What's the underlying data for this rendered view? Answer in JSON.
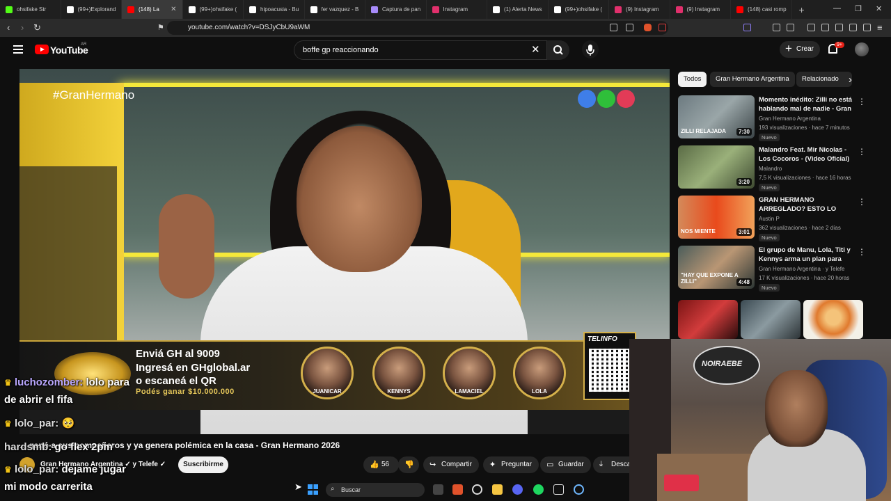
{
  "browser": {
    "tabs": [
      {
        "label": "ohsifake Str",
        "color": "#53fc18"
      },
      {
        "label": "(99+)Explorand",
        "color": "#ffffff"
      },
      {
        "label": "(148) La",
        "color": "#ff0000",
        "active": true
      },
      {
        "label": "(99+)ohsifake (",
        "color": "#ffffff"
      },
      {
        "label": "hipoacusia - Bu",
        "color": "#ffffff"
      },
      {
        "label": "fer vazquez - B",
        "color": "#ffffff"
      },
      {
        "label": "Captura de pan",
        "color": "#a78bfa"
      },
      {
        "label": "Instagram",
        "color": "#e1306c"
      },
      {
        "label": "(1) Alerta News",
        "color": "#ffffff"
      },
      {
        "label": "(99+)ohsifake (",
        "color": "#ffffff"
      },
      {
        "label": "(9) Instagram",
        "color": "#e1306c"
      },
      {
        "label": "(9) Instagram",
        "color": "#e1306c"
      },
      {
        "label": "(148) casi romp",
        "color": "#ff0000"
      }
    ],
    "new_tab": "+",
    "url": "youtube.com/watch?v=DSJyCbU9aWM"
  },
  "youtube": {
    "logo_text": "YouTube",
    "country": "AR",
    "search_value": "boffe gp reaccionando",
    "create_label": "Crear",
    "notif_count": "9+"
  },
  "video": {
    "hashtag": "#GranHermano",
    "banner_lines": [
      "Enviá GH al 9009",
      "Ingresá en GHglobal.ar",
      "o escaneá el QR"
    ],
    "banner_prize": "Podés ganar $10.000.000",
    "candidates": [
      "JUANICAR",
      "KENNYS",
      "LAMACIEL",
      "LOLA"
    ],
    "telinfo": "TELINFO",
    "title": "... ganó a sus compañeros y ya genera polémica en la casa - Gran Hermano 2026",
    "channel": "Gran Hermano Argentina",
    "channel_collab": "y Telefe",
    "subscribe": "Suscribirme",
    "likes": "56",
    "share": "Compartir",
    "ask": "Preguntar",
    "save": "Guardar",
    "download": "Descargar"
  },
  "sidebar": {
    "chips": [
      "Todos",
      "Gran Hermano Argentina",
      "Relacionado"
    ],
    "recs": [
      {
        "title": "Momento inédito: Zilli no está hablando mal de nadie - Gran ...",
        "channel": "Gran Hermano Argentina",
        "meta": "193 visualizaciones · hace 7 minutos",
        "badge": "Nuevo",
        "duration": "7:30",
        "thumb_text": "ZILLI RELAJADA"
      },
      {
        "title": "Malandro Feat. Mir Nicolas - Los Cocoros - (Video Oficial)",
        "channel": "Malandro",
        "meta": "7,5 K visualizaciones · hace 16 horas",
        "badge": "Nuevo",
        "duration": "3:20",
        "thumb_text": ""
      },
      {
        "title": "GRAN HERMANO ARREGLADO? ESTO LO CONFIRMA",
        "channel": "Austin P",
        "meta": "362 visualizaciones · hace 2 días",
        "badge": "Nuevo",
        "duration": "3:01",
        "thumb_text": "NOS MIENTE"
      },
      {
        "title": "El grupo de Manu, Lola, Titi y Kennys arma un plan para sac...",
        "channel": "Gran Hermano Argentina · y Telefe",
        "meta": "17 K visualizaciones · hace 20 horas",
        "badge": "Nuevo",
        "duration": "4:48",
        "thumb_text": "\"HAY QUE EXPONE A ZILLI\""
      }
    ]
  },
  "webcam": {
    "poster_text": "NOIRAEBE"
  },
  "chat": [
    {
      "user": "luchozomber:",
      "text": "lolo para"
    },
    {
      "user": "",
      "text": "de abrir el fifa"
    },
    {
      "user": "lolo_par:",
      "text": "🥺"
    },
    {
      "user": "hardsmb:",
      "text": "go flex 2pm"
    },
    {
      "user": "lolo_par:",
      "text": "dejame jugar"
    },
    {
      "user": "",
      "text": "mi modo carrerita"
    }
  ],
  "taskbar": {
    "search_label": "Buscar"
  }
}
